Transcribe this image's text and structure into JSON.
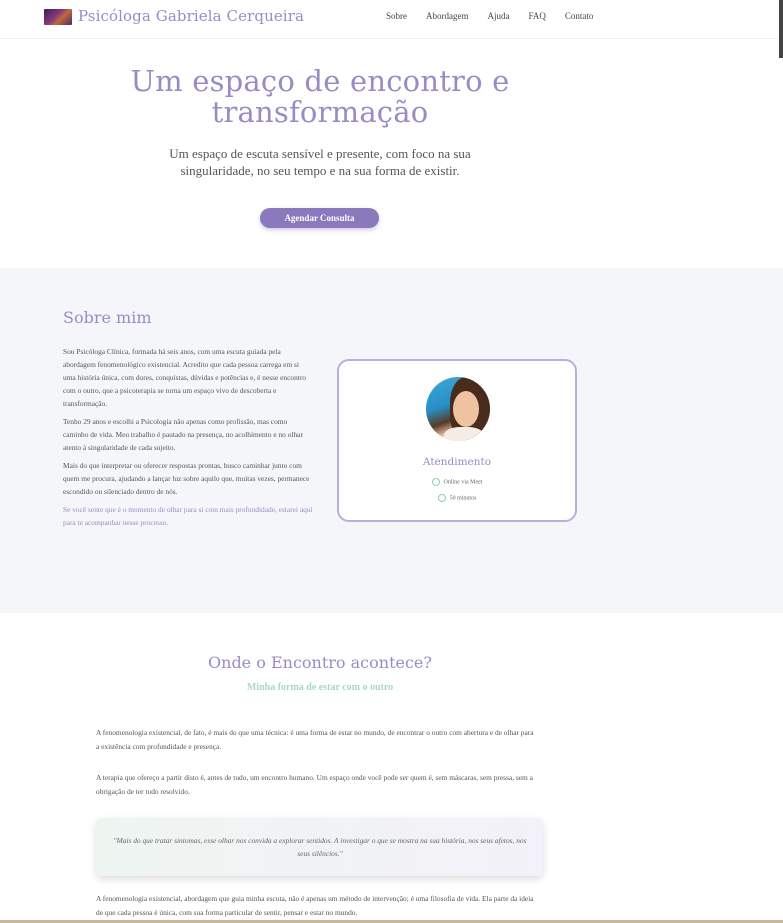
{
  "header": {
    "brand": "Psicóloga Gabriela Cerqueira",
    "logo_icon": "brand-logo-image",
    "nav": [
      "Sobre",
      "Abordagem",
      "Ajuda",
      "FAQ",
      "Contato"
    ]
  },
  "hero": {
    "title": "Um espaço de encontro e transformação",
    "subtitle": "Um espaço de escuta sensível e presente, com foco na sua singularidade, no seu tempo e na sua forma de existir.",
    "cta": "Agendar Consulta"
  },
  "about": {
    "title": "Sobre mim",
    "paragraphs": [
      "Sou Psicóloga Clínica, formada há seis anos, com uma escuta guiada pela abordagem fenomenológico existencial. Acredito que cada pessoa carrega em si uma história única, com dores, conquistas, dúvidas e potências e, é nesse encontro com o outro, que a psicoterapia se torna um espaço vivo de descoberta e transformação.",
      "Tenho 29 anos e escolhi a Psicologia não apenas como profissão, mas como caminho de vida. Meu trabalho é pautado na presença, no acolhimento e no olhar atento à singularidade de cada sujeito.",
      "Mais do que interpretar ou oferecer respostas prontas, busco caminhar junto com quem me procura, ajudando a lançar luz sobre aquilo que, muitas vezes, permanece escondido ou silenciado dentro de nós.",
      "Se você sente que é o momento de olhar para si com mais profundidade, estarei aqui para te acompanhar nesse processo."
    ],
    "card": {
      "title": "Atendimento",
      "mode": "Online via Meet",
      "duration": "50 minutos",
      "mode_icon": "chat-bubble-icon",
      "duration_icon": "clock-icon"
    }
  },
  "encounter": {
    "title": "Onde o Encontro acontece?",
    "subtitle": "Minha forma de estar com o outro",
    "p1": "A fenomenologia existencial, de fato, é mais do que uma técnica: é uma forma de estar no mundo, de encontrar o outro com abertura e de olhar para a existência com profundidade e presença.",
    "p2": "A terapia que ofereço a partir disto é, antes de tudo, um encontro humano. Um espaço onde você pode ser quem é, sem máscaras, sem pressa, sem a obrigação de ter tudo resolvido.",
    "quote": "\"Mais do que tratar sintomas, esse olhar nos convida a explorar sentidos. A investigar o que se mostra na sua história, nos seus afetos, nos seus silêncios.\"",
    "p3": "A fenomenologia existencial, abordagem que guia minha escuta, não é apenas um método de intervenção; é uma filosofia de vida. Ela parte da ideia de que cada pessoa é única, com sua forma particular de sentir, pensar e estar no mundo."
  },
  "colors": {
    "accent": "#9b8bc4",
    "button": "#8a79bd",
    "mint": "#a9d9c0",
    "section_bg": "#f5f6fa"
  }
}
